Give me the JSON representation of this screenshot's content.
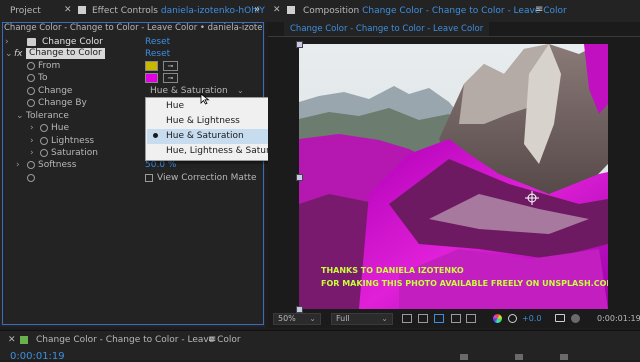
{
  "tabs": {
    "project": "Project",
    "effect_controls_prefix": "Effect Controls",
    "effect_controls_layer": "daniela-izotenko-hOhlY",
    "composition_prefix": "Composition",
    "composition_name": "Change Color - Change to Color - Leave Color"
  },
  "ec_breadcrumb": "Change Color - Change to Color - Leave Color • daniela-izotenko-hOhlYh",
  "comp_breadcrumb": "Change Color - Change to Color - Leave Color",
  "effects": {
    "change_color": {
      "name": "Change Color",
      "reset": "Reset"
    },
    "change_to_color": {
      "name": "Change to Color",
      "reset": "Reset"
    },
    "from": {
      "label": "From",
      "color": "#c8b800"
    },
    "to": {
      "label": "To",
      "color": "#e000e0"
    },
    "change": {
      "label": "Change",
      "value": "Hue & Saturation"
    },
    "change_by": {
      "label": "Change By"
    },
    "tolerance": {
      "label": "Tolerance"
    },
    "hue": {
      "label": "Hue"
    },
    "lightness": {
      "label": "Lightness"
    },
    "saturation": {
      "label": "Saturation"
    },
    "softness": {
      "label": "Softness",
      "value": "50.0 %"
    },
    "view_matte": {
      "label": "View Correction Matte",
      "checked": false
    }
  },
  "dropdown": {
    "options": [
      "Hue",
      "Hue & Lightness",
      "Hue & Saturation",
      "Hue, Lightness & Saturation"
    ],
    "selected": "Hue & Saturation"
  },
  "credit": {
    "line1": "THANKS TO DANIELA IZOTENKO",
    "line2": "FOR MAKING THIS PHOTO AVAILABLE FREELY ON UNSPLASH.COM"
  },
  "viewer_controls": {
    "zoom": "50%",
    "resolution": "Full",
    "exposure": "+0.0",
    "timecode": "0:00:01:19"
  },
  "timeline": {
    "tab": "Change Color - Change to Color - Leave Color",
    "timecode": "0:00:01:19"
  },
  "colors": {
    "accent_blue": "#3d8fe0",
    "credit_green": "#c8ff3c",
    "magenta": "#e000e0"
  }
}
